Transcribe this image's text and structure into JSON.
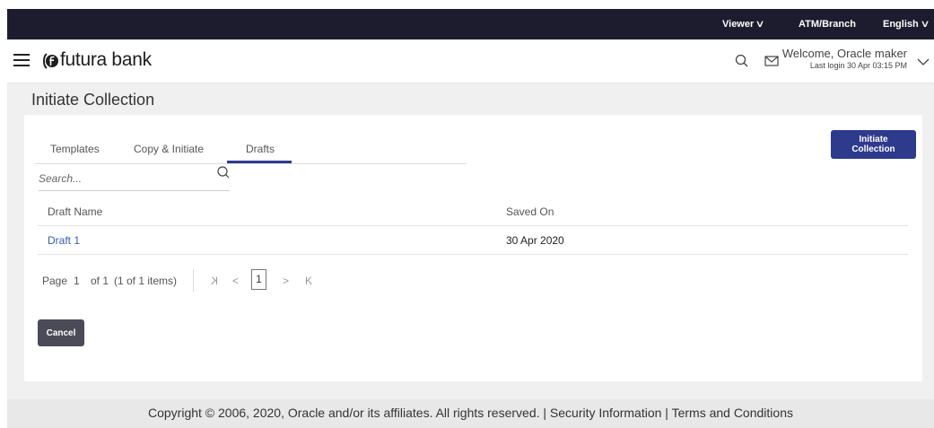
{
  "topbar": {
    "viewer": "Viewer",
    "atm": "ATM/Branch",
    "language": "English"
  },
  "header": {
    "brand": "futura bank",
    "welcome": "Welcome, Oracle maker",
    "last_login": "Last login 30 Apr 03:15 PM"
  },
  "page": {
    "title": "Initiate Collection"
  },
  "tabs": [
    {
      "label": "Templates"
    },
    {
      "label": "Copy & Initiate"
    },
    {
      "label": "Drafts"
    }
  ],
  "active_tab": "Drafts",
  "actions": {
    "initiate": "Initiate Collection",
    "cancel": "Cancel"
  },
  "search": {
    "placeholder": "Search...",
    "value": ""
  },
  "table": {
    "headers": [
      "Draft Name",
      "Saved On"
    ],
    "rows": [
      {
        "name": "Draft 1",
        "saved_on": "30 Apr 2020"
      }
    ]
  },
  "pagination": {
    "page_label": "Page",
    "page": "1",
    "of": "of 1",
    "items": "(1 of 1 items)",
    "current": "1",
    "first": "K",
    "prev": "<",
    "next": ">",
    "last": "K"
  },
  "footer": {
    "text": "Copyright © 2006, 2020, Oracle and/or its affiliates. All rights reserved. | Security Information | Terms and Conditions"
  },
  "colors": {
    "topbar": "#1c1c2e",
    "primary": "#2e3a8c",
    "cancel": "#4a4b57",
    "link": "#3a5da8"
  }
}
